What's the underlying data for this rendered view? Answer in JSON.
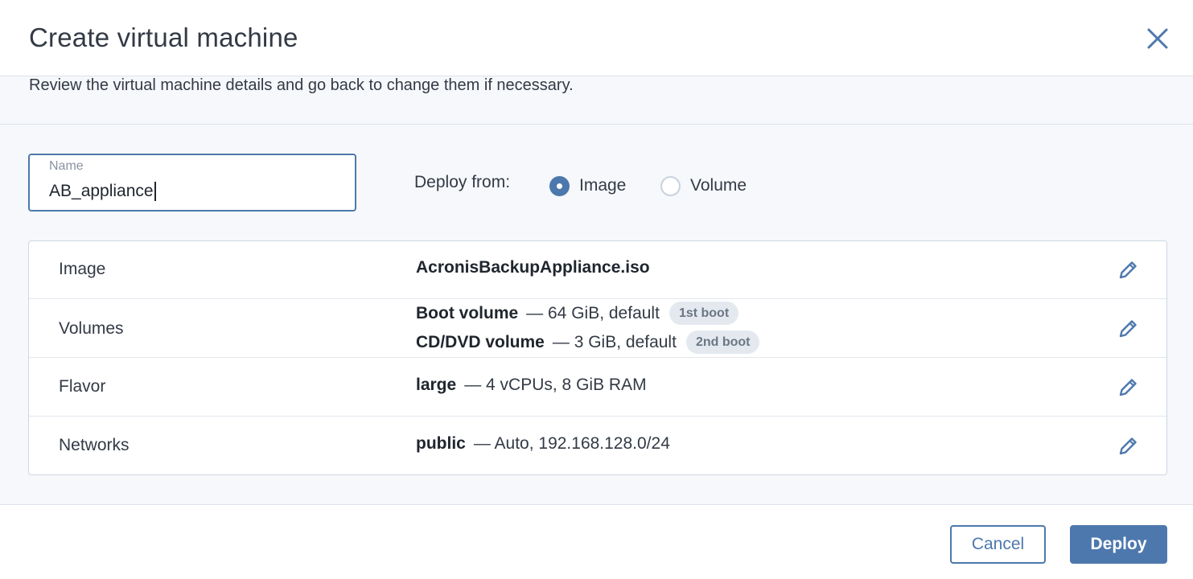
{
  "dialog": {
    "title": "Create virtual machine",
    "subtitle": "Review the virtual machine details and go back to change them if necessary."
  },
  "name_field": {
    "label": "Name",
    "value": "AB_appliance"
  },
  "deploy_from": {
    "label": "Deploy from:",
    "options": [
      {
        "label": "Image",
        "selected": true
      },
      {
        "label": "Volume",
        "selected": false
      }
    ]
  },
  "summary": {
    "image": {
      "label": "Image",
      "value": "AcronisBackupAppliance.iso"
    },
    "volumes": {
      "label": "Volumes",
      "items": [
        {
          "name": "Boot volume",
          "detail": "— 64 GiB, default",
          "badge": "1st boot"
        },
        {
          "name": "CD/DVD volume",
          "detail": "— 3 GiB, default",
          "badge": "2nd boot"
        }
      ]
    },
    "flavor": {
      "label": "Flavor",
      "name": "large",
      "detail": "— 4 vCPUs, 8 GiB RAM"
    },
    "networks": {
      "label": "Networks",
      "name": "public",
      "detail": "— Auto, 192.168.128.0/24"
    }
  },
  "footer": {
    "cancel_label": "Cancel",
    "deploy_label": "Deploy"
  },
  "colors": {
    "accent": "#4d78ad",
    "badge_bg": "#e4e9f0",
    "band_bg": "#f6f8fb"
  },
  "icons": {
    "close": "close-icon",
    "edit": "pencil-icon"
  }
}
